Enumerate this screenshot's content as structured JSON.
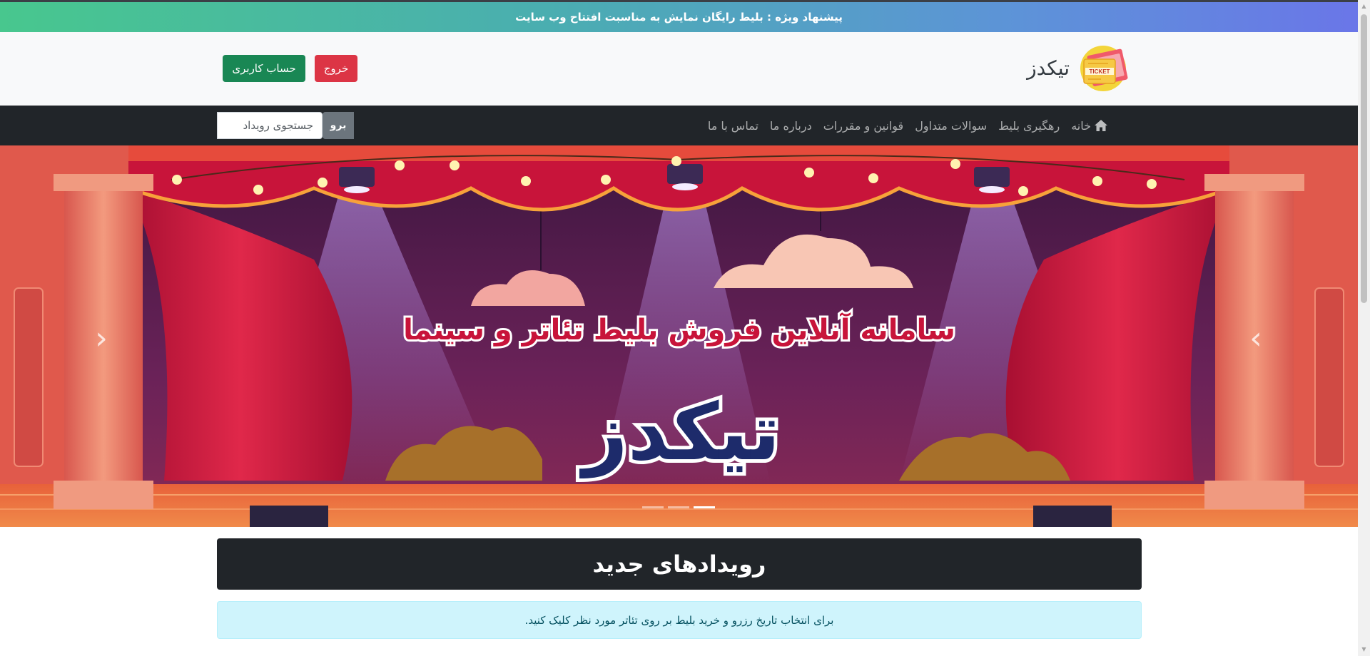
{
  "promo": {
    "text": "پیشنهاد ویژه : بلیط رایگان نمایش به مناسبت افتتاح وب سایت"
  },
  "header": {
    "brand_name": "تیکدز",
    "logo_text": "TICKET",
    "account_button": "حساب کاربری",
    "logout_button": "خروج"
  },
  "nav": {
    "home": "خانه",
    "tracking": "رهگیری بلیط",
    "faq": "سوالات متداول",
    "rules": "قوانین و مقررات",
    "about": "درباره ما",
    "contact": "تماس با ما",
    "search_placeholder": "جستجوی رویداد",
    "search_button": "برو"
  },
  "hero": {
    "subtitle": "سامانه آنلاین فروش بلیط تئاتر و سینما",
    "title": "تیکدز",
    "prev_icon": "chevron-left-icon",
    "next_icon": "chevron-right-icon",
    "slide_count": 3,
    "active_slide": 1
  },
  "events": {
    "title": "رویدادهای جدید",
    "info": "برای انتخاب تاریخ رزرو و خرید بلیط بر روی تئاتر مورد نظر کلیک کنید."
  },
  "colors": {
    "navbar": "#212529",
    "account_button": "#198754",
    "logout_button": "#dc3545",
    "info_bg": "#cff4fc",
    "curtain": "#c8143a",
    "stage_bg": "#5a1f4a"
  }
}
